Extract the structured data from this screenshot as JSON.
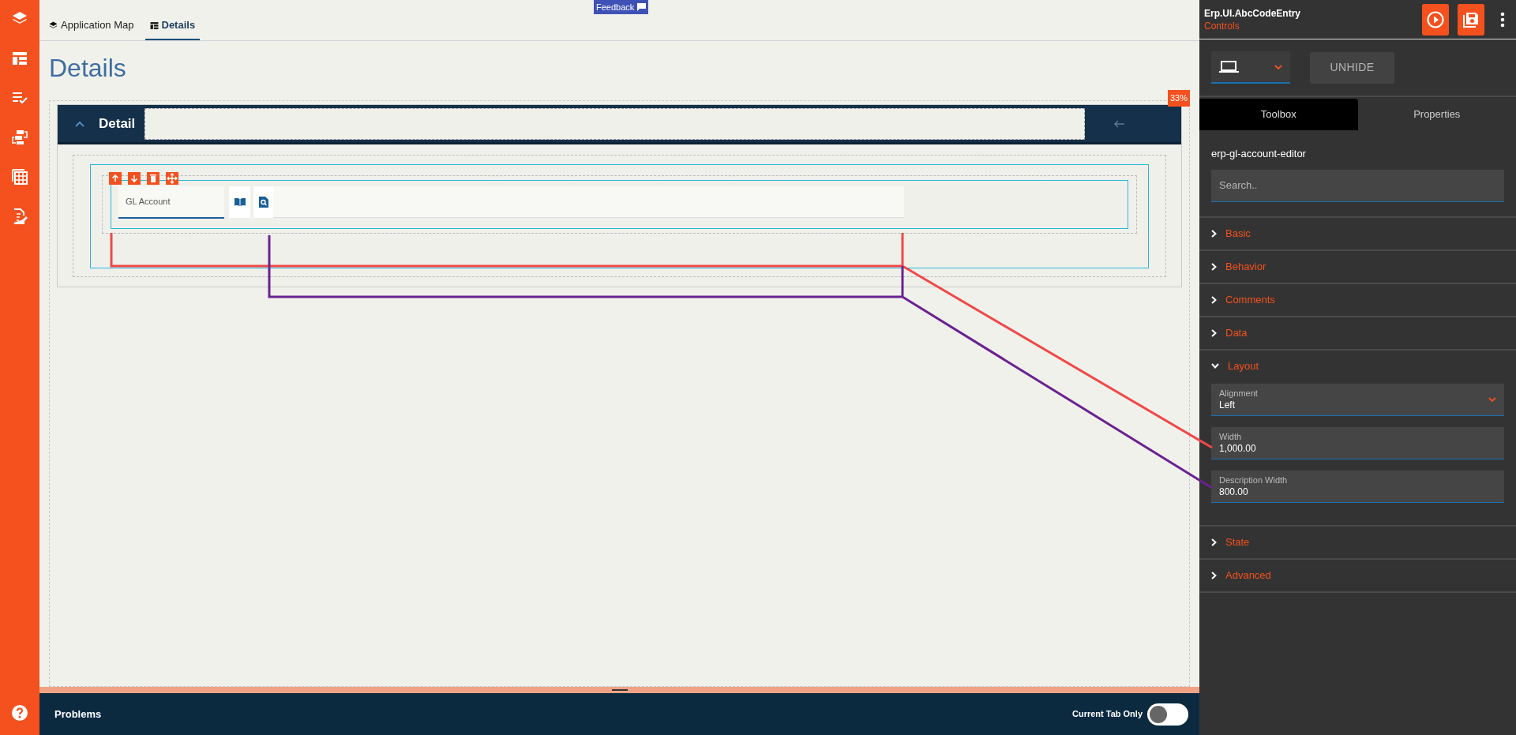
{
  "feedback_badge": "Feedback",
  "tabs": [
    {
      "label": "Application Map",
      "selected": false
    },
    {
      "label": "Details",
      "selected": true
    }
  ],
  "page_title": "Details",
  "panel": {
    "title": "Detail",
    "expanded": true,
    "zoom_badge": "33%"
  },
  "field": {
    "label": "GL Account"
  },
  "problems_bar": {
    "title": "Problems",
    "toggle_label": "Current Tab Only",
    "toggle_on": false
  },
  "inspector": {
    "title": "Erp.UI.AbcCodeEntry",
    "subtitle": "Controls",
    "unhide_button": "UNHIDE",
    "tabs": [
      {
        "label": "Toolbox",
        "selected": true
      },
      {
        "label": "Properties",
        "selected": false
      }
    ],
    "component": "erp-gl-account-editor",
    "search": {
      "placeholder": "Search.."
    },
    "sections": [
      {
        "label": "Basic",
        "expanded": false
      },
      {
        "label": "Behavior",
        "expanded": false
      },
      {
        "label": "Comments",
        "expanded": false
      },
      {
        "label": "Data",
        "expanded": false
      },
      {
        "label": "Layout",
        "expanded": true,
        "fields": [
          {
            "kind": "select",
            "label": "Alignment",
            "value": "Left"
          },
          {
            "kind": "number",
            "label": "Width",
            "value": "1,000.00"
          },
          {
            "kind": "number",
            "label": "Description Width",
            "value": "800.00"
          }
        ]
      },
      {
        "label": "State",
        "expanded": false
      },
      {
        "label": "Advanced",
        "expanded": false
      }
    ]
  }
}
